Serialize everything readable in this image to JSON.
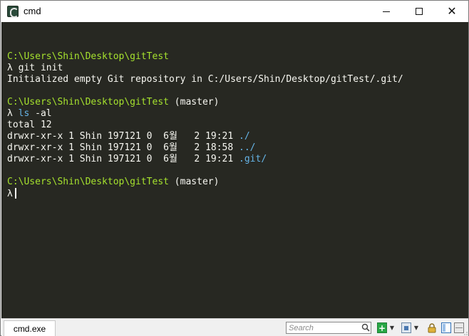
{
  "window": {
    "title": "cmd",
    "close_glyph": "✕"
  },
  "console": {
    "lines": [
      {
        "segments": [
          {
            "text": "",
            "color": "white"
          }
        ]
      },
      {
        "segments": [
          {
            "text": "C:\\Users\\Shin\\Desktop\\gitTest",
            "color": "green"
          }
        ]
      },
      {
        "segments": [
          {
            "text": "λ git init",
            "color": "white"
          }
        ]
      },
      {
        "segments": [
          {
            "text": "Initialized empty Git repository in C:/Users/Shin/Desktop/gitTest/.git/",
            "color": "white"
          }
        ]
      },
      {
        "segments": [
          {
            "text": "",
            "color": "white"
          }
        ]
      },
      {
        "segments": [
          {
            "text": "C:\\Users\\Shin\\Desktop\\gitTest",
            "color": "green"
          },
          {
            "text": " (master)",
            "color": "white"
          }
        ]
      },
      {
        "segments": [
          {
            "text": "λ ",
            "color": "white"
          },
          {
            "text": "ls",
            "color": "blue"
          },
          {
            "text": " -al",
            "color": "white"
          }
        ]
      },
      {
        "segments": [
          {
            "text": "total 12",
            "color": "white"
          }
        ]
      },
      {
        "segments": [
          {
            "text": "drwxr-xr-x 1 Shin 197121 0  6월   2 19:21 ",
            "color": "white"
          },
          {
            "text": "./",
            "color": "blue"
          }
        ]
      },
      {
        "segments": [
          {
            "text": "drwxr-xr-x 1 Shin 197121 0  6월   2 18:58 ",
            "color": "white"
          },
          {
            "text": "../",
            "color": "blue"
          }
        ]
      },
      {
        "segments": [
          {
            "text": "drwxr-xr-x 1 Shin 197121 0  6월   2 19:21 ",
            "color": "white"
          },
          {
            "text": ".git/",
            "color": "blue"
          }
        ]
      },
      {
        "segments": [
          {
            "text": "",
            "color": "white"
          }
        ]
      },
      {
        "segments": [
          {
            "text": "C:\\Users\\Shin\\Desktop\\gitTest",
            "color": "green"
          },
          {
            "text": " (master)",
            "color": "white"
          }
        ]
      },
      {
        "segments": [
          {
            "text": "λ",
            "color": "white"
          }
        ],
        "cursor": true
      }
    ]
  },
  "statusbar": {
    "tab_label": "cmd.exe",
    "search_placeholder": "Search",
    "add_glyph": "+",
    "dropdown_glyph": "▼"
  },
  "colors": {
    "console_bg": "#272822",
    "prompt_path": "#a6e22e",
    "dir_name": "#66b5e8",
    "text": "#f8f8f2"
  }
}
